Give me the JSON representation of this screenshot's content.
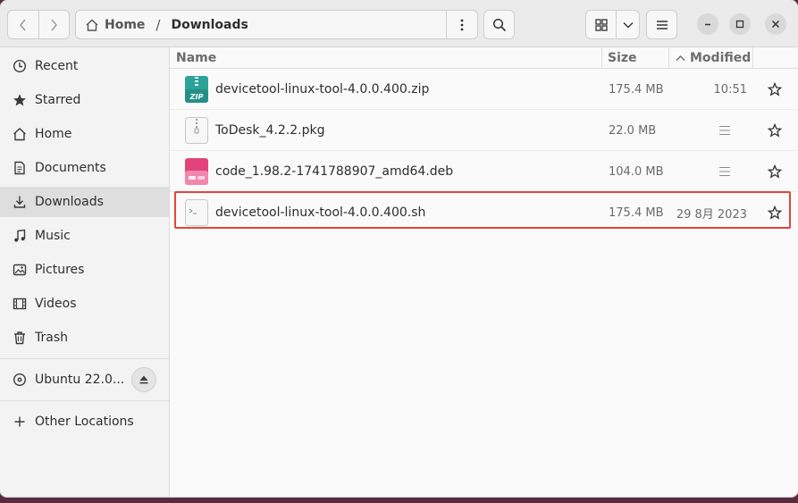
{
  "header": {
    "back_icon": "chevron-left-icon",
    "forward_icon": "chevron-right-icon",
    "path_home_label": "Home",
    "path_separator": "/",
    "path_current_label": "Downloads",
    "path_menu_icon": "vertical-dots-icon",
    "search_icon": "search-icon",
    "view_grid_icon": "grid-icon",
    "view_dropdown_icon": "chevron-down-icon",
    "menu_icon": "hamburger-icon",
    "minimize_icon": "minimize-icon",
    "maximize_icon": "maximize-icon",
    "close_icon": "close-icon"
  },
  "sidebar": {
    "items": [
      {
        "label": "Recent",
        "icon": "clock-icon"
      },
      {
        "label": "Starred",
        "icon": "star-icon"
      },
      {
        "label": "Home",
        "icon": "home-icon"
      },
      {
        "label": "Documents",
        "icon": "document-icon"
      },
      {
        "label": "Downloads",
        "icon": "download-icon",
        "active": true
      },
      {
        "label": "Music",
        "icon": "music-icon"
      },
      {
        "label": "Pictures",
        "icon": "picture-icon"
      },
      {
        "label": "Videos",
        "icon": "video-icon"
      },
      {
        "label": "Trash",
        "icon": "trash-icon"
      }
    ],
    "device": {
      "label": "Ubuntu 22.0...",
      "icon": "disc-icon",
      "eject_icon": "eject-icon"
    },
    "other_locations": {
      "label": "Other Locations",
      "icon": "plus-icon"
    }
  },
  "columns": {
    "name": "Name",
    "size": "Size",
    "modified": "Modified",
    "sort_icon": "sort-up-icon"
  },
  "files": [
    {
      "name": "devicetool-linux-tool-4.0.0.400.zip",
      "size": "175.4 MB",
      "modified": "10:51",
      "icon": "zip-archive-icon"
    },
    {
      "name": "ToDesk_4.2.2.pkg",
      "size": "22.0 MB",
      "modified": "",
      "icon": "package-icon"
    },
    {
      "name": "code_1.98.2-1741788907_amd64.deb",
      "size": "104.0 MB",
      "modified": "",
      "icon": "deb-package-icon"
    },
    {
      "name": "devicetool-linux-tool-4.0.0.400.sh",
      "size": "175.4 MB",
      "modified": "29 8月 2023",
      "icon": "script-icon"
    }
  ],
  "colors": {
    "highlight": "#e0463a",
    "zip_icon": "#2aa39a",
    "deb_icon": "#e2437a"
  }
}
